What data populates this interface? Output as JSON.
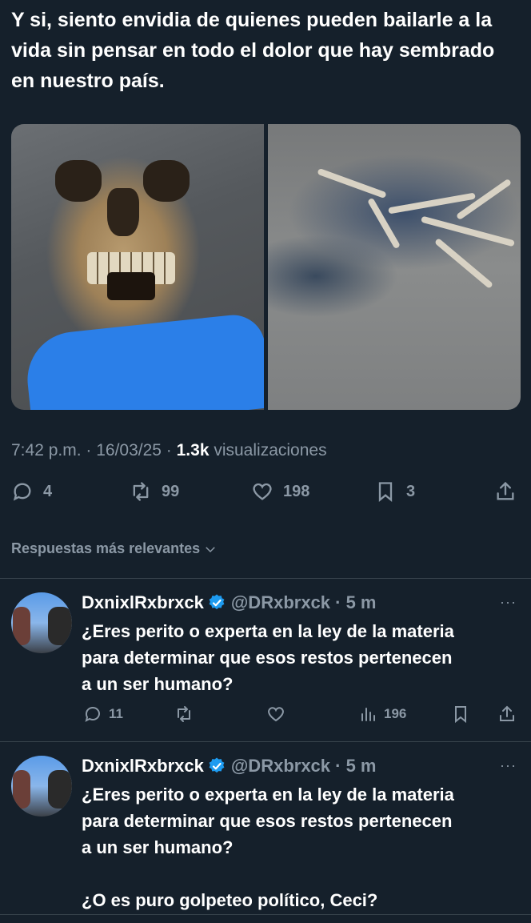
{
  "tweet": {
    "text": "Y si, siento envidia de quienes pueden bailarle a la vida sin pensar en todo el dolor que hay sembrado en nuestro país.",
    "time": "7:42 p.m. · 16/03/25 · ",
    "views_count": "1.3k",
    "views_label": " visualizaciones"
  },
  "actions": {
    "replies": "4",
    "retweets": "99",
    "likes": "198",
    "bookmarks": "3"
  },
  "sort": {
    "label": "Respuestas más relevantes"
  },
  "replies": [
    {
      "name": "DxnixlRxbrxck",
      "handle": "@DRxbrxck · 5 m",
      "more": "···",
      "lines": [
        "¿Eres perito o experta en la ley de la materia",
        "para determinar que esos restos pertenecen",
        "a un ser humano?"
      ],
      "replies": "11",
      "views": "196"
    },
    {
      "name": "DxnixlRxbrxck",
      "handle": "@DRxbrxck · 5 m",
      "more": "···",
      "lines": [
        "¿Eres perito o experta en la ley de la materia",
        "para determinar que esos restos pertenecen",
        "a un ser humano?",
        "",
        "¿O es puro golpeteo político, Ceci?"
      ]
    }
  ],
  "colors": {
    "background": "#15202b",
    "secondary_text": "#8b98a5",
    "verified": "#1d9bf0",
    "divider": "#38444d"
  },
  "icons": [
    "reply-icon",
    "retweet-icon",
    "like-icon",
    "bookmark-icon",
    "share-icon",
    "views-icon",
    "verified-icon",
    "chevron-down-icon"
  ]
}
